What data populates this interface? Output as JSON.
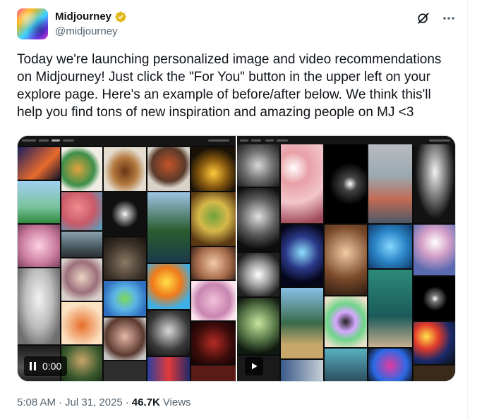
{
  "author": {
    "display_name": "Midjourney",
    "handle": "@midjourney",
    "verified": true,
    "verified_color": "#e2b719"
  },
  "actions": {
    "grok_icon": "grok-icon",
    "more_icon": "more-icon"
  },
  "tweet": {
    "text": "Today we're launching personalized image and video recommendations on Midjourney! Just click the \"For You\" button in the upper left on your explore page. Here's an example of before/after below. We think this'll help you find tons of new inspiration and amazing people on MJ <3"
  },
  "media": {
    "video_time": "0:00",
    "left_panel_icon": "pause-icon",
    "right_panel_icon": "play-icon"
  },
  "meta": {
    "time": "5:08 AM",
    "sep1": "·",
    "date": "Jul 31, 2025",
    "sep2": "·",
    "views_count": "46.7K",
    "views_label": "Views"
  }
}
